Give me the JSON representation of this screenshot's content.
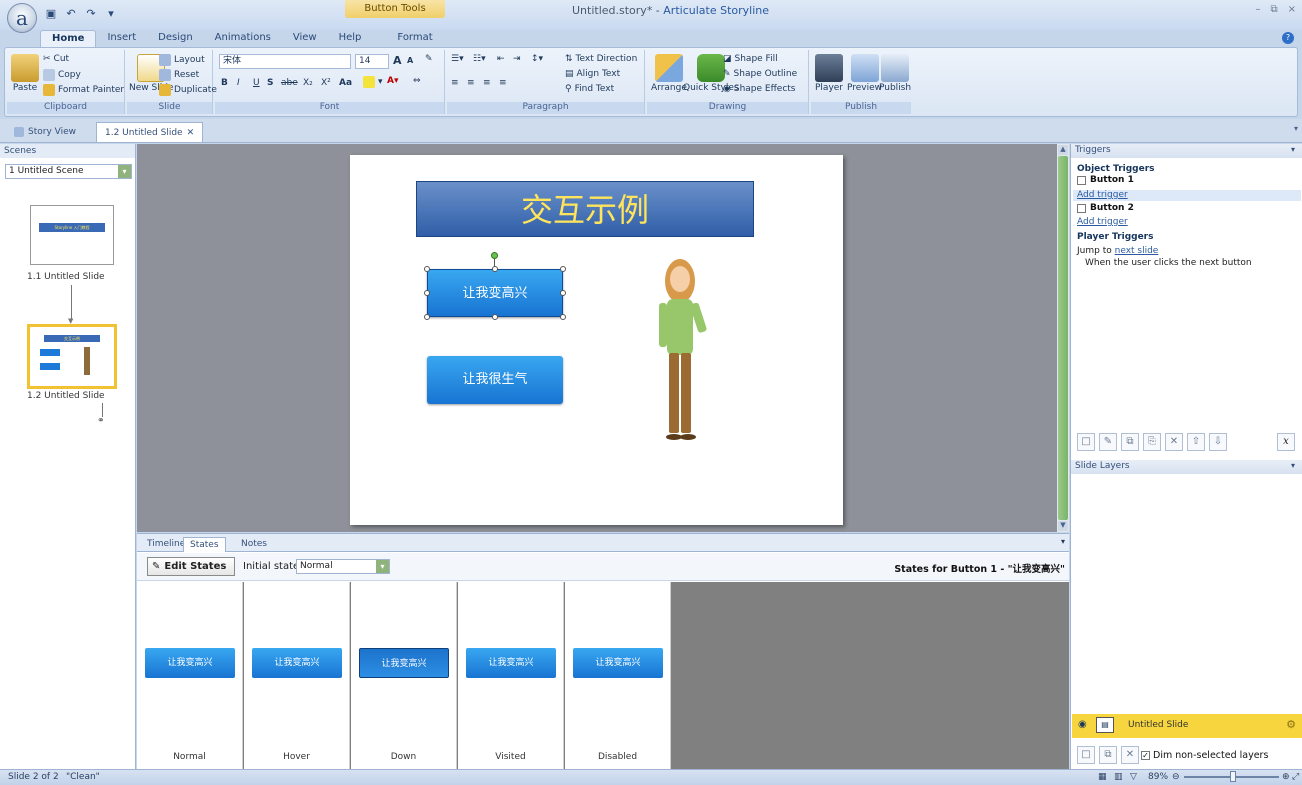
{
  "titlebar": {
    "context_tab": "Button Tools",
    "document": "Untitled.story* -",
    "app": "Articulate Storyline",
    "controls": [
      "–",
      "⧉",
      "×"
    ]
  },
  "ribbon_tabs": [
    "Home",
    "Insert",
    "Design",
    "Animations",
    "View",
    "Help",
    "Format"
  ],
  "ribbon": {
    "clipboard": {
      "paste": "Paste",
      "cut": "Cut",
      "copy": "Copy",
      "format_painter": "Format Painter",
      "label": "Clipboard"
    },
    "slide": {
      "new_slide": "New Slide",
      "layout": "Layout",
      "reset": "Reset",
      "duplicate": "Duplicate",
      "label": "Slide"
    },
    "font": {
      "family": "宋体",
      "size": "14",
      "label": "Font",
      "bold": "B",
      "italic": "I",
      "underline": "U",
      "shadow": "S",
      "strike": "abe",
      "subscript": "X₂",
      "superscript": "X²",
      "case": "Aa",
      "grow": "A",
      "shrink": "A"
    },
    "paragraph": {
      "text_direction": "Text Direction",
      "align_text": "Align Text",
      "find_text": "Find Text",
      "label": "Paragraph"
    },
    "drawing": {
      "arrange": "Arrange",
      "quick_styles": "Quick Styles",
      "shape_fill": "Shape Fill",
      "shape_outline": "Shape Outline",
      "shape_effects": "Shape Effects",
      "label": "Drawing"
    },
    "publish": {
      "player": "Player",
      "preview": "Preview",
      "publish": "Publish",
      "label": "Publish"
    }
  },
  "doc_tabs": [
    {
      "label": "Story View"
    },
    {
      "label": "1.2 Untitled Slide"
    }
  ],
  "scenes": {
    "header": "Scenes",
    "selected_scene": "1 Untitled Scene",
    "slides": [
      {
        "label": "1.1 Untitled Slide",
        "thumb_title": "Storyline 入门教程"
      },
      {
        "label": "1.2 Untitled Slide",
        "thumb_title": "交互示例"
      }
    ]
  },
  "slide": {
    "title": "交互示例",
    "button1": "让我变高兴",
    "button2": "让我很生气"
  },
  "bottom": {
    "tabs": [
      "Timeline",
      "States",
      "Notes"
    ],
    "edit_states": "Edit States",
    "initial_state_label": "Initial state:",
    "initial_state_value": "Normal",
    "states_for": "States for Button 1 - \"让我变高兴\"",
    "states": [
      {
        "name": "Normal",
        "text": "让我变高兴"
      },
      {
        "name": "Hover",
        "text": "让我变高兴"
      },
      {
        "name": "Down",
        "text": "让我变高兴"
      },
      {
        "name": "Visited",
        "text": "让我变高兴"
      },
      {
        "name": "Disabled",
        "text": "让我变高兴"
      }
    ]
  },
  "triggers": {
    "header": "Triggers",
    "object_triggers": "Object Triggers",
    "button1": "Button 1",
    "add_trigger_1": "Add trigger",
    "button2": "Button 2",
    "add_trigger_2": "Add trigger",
    "player_triggers": "Player Triggers",
    "jump_to": "Jump to",
    "next_slide": "next slide",
    "when": "When the user clicks the next button",
    "variables": "x"
  },
  "layers": {
    "header": "Slide Layers",
    "base_layer": "Untitled Slide",
    "dim_label": "Dim non-selected layers",
    "dim_checked": true
  },
  "status": {
    "slide": "Slide 2 of 2",
    "theme": "\"Clean\"",
    "zoom": "89%"
  }
}
